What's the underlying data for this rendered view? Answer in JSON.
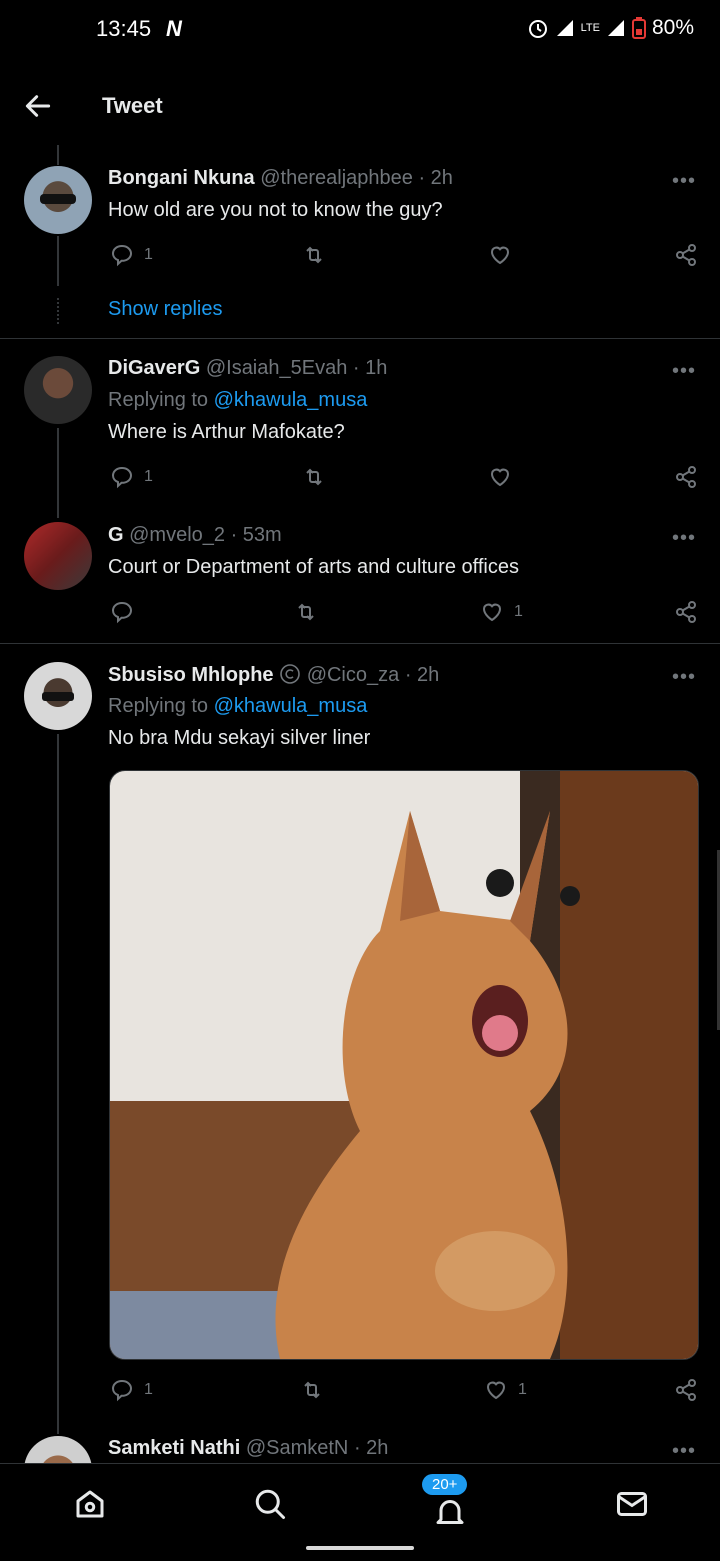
{
  "status_bar": {
    "time": "13:45",
    "carrier_logo": "N",
    "network": "LTE",
    "battery": "80%",
    "icons": [
      "alarm-icon",
      "signal-icon",
      "lte-icon",
      "signal-icon",
      "battery-icon"
    ]
  },
  "header": {
    "title": "Tweet",
    "back_icon": "arrow-left-icon"
  },
  "tweets": [
    {
      "name": "Bongani Nkuna",
      "handle": "@therealjaphbee",
      "time": "· 2h",
      "text": "How old are you not to know the guy?",
      "replies": "1",
      "retweets": "",
      "likes": "",
      "show_replies": "Show replies"
    },
    {
      "name": "DiGaverG",
      "handle": "@Isaiah_5Evah",
      "time": "· 1h",
      "replying_to_prefix": "Replying to",
      "replying_to": "@khawula_musa",
      "text": "Where is Arthur Mafokate?",
      "replies": "1",
      "retweets": "",
      "likes": ""
    },
    {
      "name": "G",
      "handle": "@mvelo_2",
      "time": "· 53m",
      "text": "Court or Department of arts and culture offices",
      "replies": "",
      "retweets": "",
      "likes": "1"
    },
    {
      "name": "Sbusiso Mhlophe",
      "handle": "@Cico_za",
      "time": "· 2h",
      "replying_to_prefix": "Replying to",
      "replying_to": "@khawula_musa",
      "text": "No bra Mdu sekayi silver liner",
      "replies": "1",
      "retweets": "",
      "likes": "1",
      "media": "cat-photo"
    },
    {
      "name": "Samketi Nathi",
      "handle": "@SamketN",
      "time": "· 2h"
    }
  ],
  "more_label": "•••",
  "bottom_nav": {
    "items": [
      "home-icon",
      "search-icon",
      "notifications-icon",
      "messages-icon"
    ],
    "notifications_badge": "20+"
  },
  "colors": {
    "accent": "#1d9bf0",
    "muted": "#71767b",
    "background": "#000000",
    "text": "#e7e9ea"
  }
}
